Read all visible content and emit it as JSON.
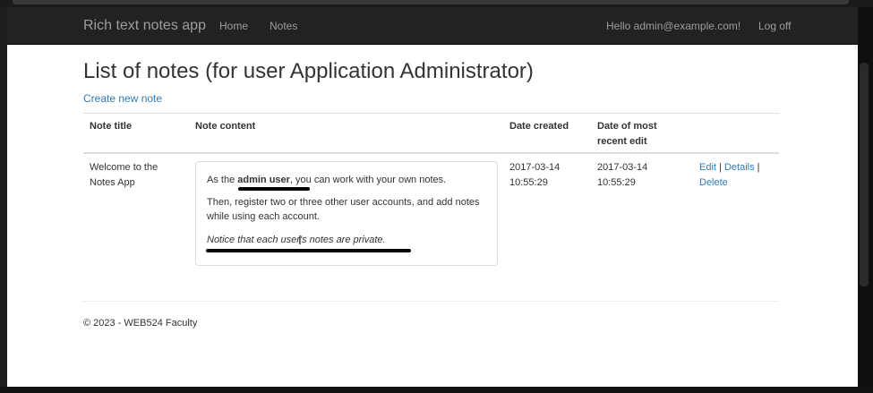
{
  "navbar": {
    "brand": "Rich text notes app",
    "home": "Home",
    "notes": "Notes",
    "greeting": "Hello admin@example.com!",
    "logoff": "Log off"
  },
  "page": {
    "title": "List of notes (for user Application Administrator)",
    "create_link": "Create new note"
  },
  "table": {
    "headers": {
      "title": "Note title",
      "content": "Note content",
      "created": "Date created",
      "edited_1": "Date of most",
      "edited_2": "recent edit"
    },
    "rows": [
      {
        "title_1": "Welcome to the",
        "title_2": "Notes App",
        "content": {
          "p1_prefix": "As the ",
          "p1_bold": "admin user",
          "p1_suffix": ", you can work with your own notes.",
          "p2": "Then, register two or three other user accounts, and add notes while using each account.",
          "p3": "Notice that each user's notes are private."
        },
        "created_date": "2017-03-14",
        "created_time": "10:55:29",
        "edited_date": "2017-03-14",
        "edited_time": "10:55:29",
        "actions": {
          "edit": "Edit",
          "sep1": " | ",
          "details": "Details",
          "sep2": " |",
          "delete": "Delete"
        }
      }
    ]
  },
  "footer": "© 2023 - WEB524 Faculty",
  "icons": {
    "cursor": "text-cursor-icon"
  }
}
